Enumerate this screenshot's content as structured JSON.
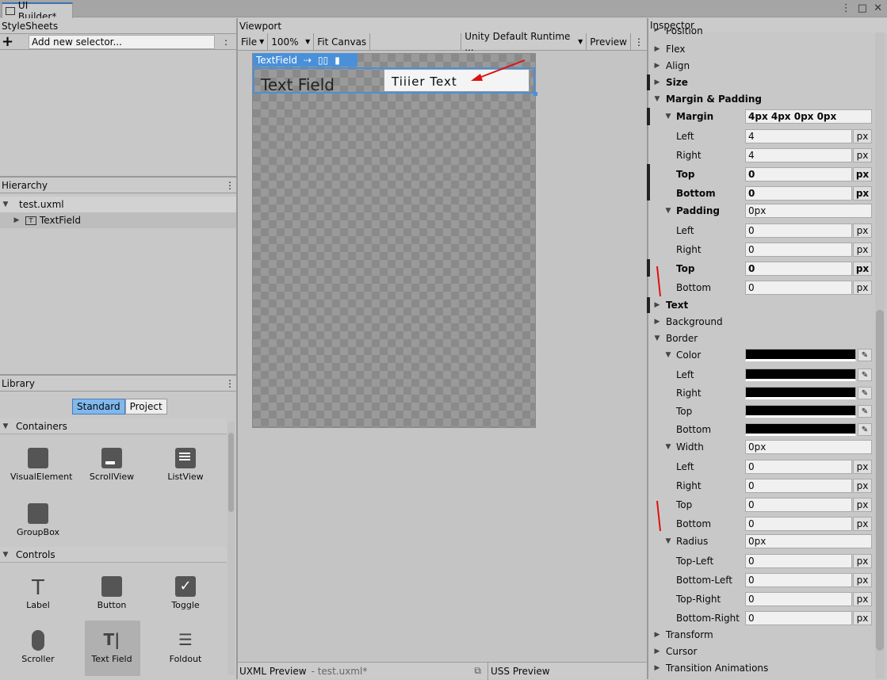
{
  "window": {
    "tab_title": "UI Builder*"
  },
  "stylesheets": {
    "title": "StyleSheets",
    "add_button": "+",
    "selector_placeholder": "Add new selector...",
    "menu": ":"
  },
  "hierarchy": {
    "title": "Hierarchy",
    "menu": "⋮",
    "root": "test.uxml",
    "child": "TextField"
  },
  "library": {
    "title": "Library",
    "menu": "⋮",
    "tab_standard": "Standard",
    "tab_project": "Project",
    "sections": {
      "containers": "Containers",
      "controls": "Controls"
    },
    "items": {
      "visual_element": "VisualElement",
      "scroll_view": "ScrollView",
      "list_view": "ListView",
      "group_box": "GroupBox",
      "label": "Label",
      "button": "Button",
      "toggle": "Toggle",
      "scroller": "Scroller",
      "text_field": "Text Field",
      "foldout": "Foldout"
    }
  },
  "viewport": {
    "title": "Viewport",
    "file": "File",
    "zoom": "100%",
    "fit": "Fit Canvas",
    "theme": "Unity Default Runtime ...",
    "preview": "Preview",
    "menu": "⋮",
    "element_tag": "TextField",
    "text_field_label": "Text Field",
    "text_field_value": "Tiiier Text"
  },
  "bottom": {
    "uxml_preview": "UXML Preview",
    "uxml_file": "- test.uxml*",
    "uss_preview": "USS Preview"
  },
  "inspector": {
    "title": "Inspector",
    "position": "Position",
    "flex": "Flex",
    "align": "Align",
    "size": "Size",
    "margin_padding": "Margin & Padding",
    "margin": "Margin",
    "margin_value": "4px 4px 0px 0px",
    "left": "Left",
    "right": "Right",
    "top": "Top",
    "bottom": "Bottom",
    "padding": "Padding",
    "padding_value": "0px",
    "text": "Text",
    "background": "Background",
    "border": "Border",
    "color": "Color",
    "width": "Width",
    "width_value": "0px",
    "radius": "Radius",
    "radius_value": "0px",
    "top_left": "Top-Left",
    "bottom_left": "Bottom-Left",
    "top_right": "Top-Right",
    "bottom_right": "Bottom-Right",
    "transform": "Transform",
    "cursor": "Cursor",
    "transition": "Transition Animations",
    "unit": "px",
    "v4": "4",
    "v0": "0"
  },
  "colors": {
    "accent": "#3a72b0",
    "selection": "#4a90d9",
    "annotation": "#e01010"
  }
}
